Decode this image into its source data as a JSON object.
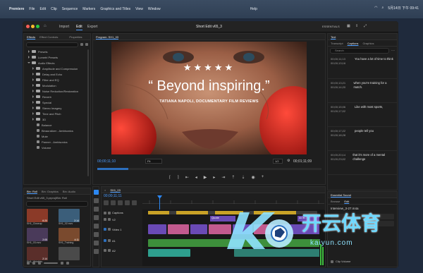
{
  "menubar": {
    "apple": "",
    "items": [
      "Premiere",
      "File",
      "Edit",
      "Clip",
      "Sequence",
      "Markers",
      "Graphics and Titles",
      "View",
      "Window",
      "Help"
    ],
    "clock": "5月14日 下午 09:41"
  },
  "header": {
    "tabs": [
      "Import",
      "Edit",
      "Export"
    ],
    "active_tab": "Edit",
    "project_title": "Short Edit v65_3",
    "workspace": "ESSENTIALS"
  },
  "effects_panel": {
    "tabs": [
      "Effects",
      "Effect Controls",
      "Properties"
    ],
    "search_placeholder": "",
    "tree": [
      {
        "label": "Presets",
        "type": "folder",
        "level": 0
      },
      {
        "label": "Lumetri Presets",
        "type": "folder",
        "level": 0
      },
      {
        "label": "Audio Effects",
        "type": "folder",
        "level": 0,
        "open": true
      },
      {
        "label": "Amplitude and Compression",
        "type": "folder",
        "level": 1
      },
      {
        "label": "Delay and Echo",
        "type": "folder",
        "level": 1
      },
      {
        "label": "Filter and EQ",
        "type": "folder",
        "level": 1
      },
      {
        "label": "Modulation",
        "type": "folder",
        "level": 1
      },
      {
        "label": "Noise Reduction/Restoration",
        "type": "folder",
        "level": 1
      },
      {
        "label": "Reverb",
        "type": "folder",
        "level": 1
      },
      {
        "label": "Special",
        "type": "folder",
        "level": 1
      },
      {
        "label": "Stereo Imagery",
        "type": "folder",
        "level": 1
      },
      {
        "label": "Time and Pitch",
        "type": "folder",
        "level": 1
      },
      {
        "label": "3D",
        "type": "folder",
        "level": 1
      },
      {
        "label": "Balance",
        "type": "item",
        "level": 2
      },
      {
        "label": "Binauralizer - Ambisonics",
        "type": "item",
        "level": 2
      },
      {
        "label": "Mute",
        "type": "item",
        "level": 2
      },
      {
        "label": "Panner - Ambisonics",
        "type": "item",
        "level": 2
      },
      {
        "label": "Volume",
        "type": "item",
        "level": 2
      }
    ]
  },
  "bin_panel": {
    "tabs": [
      "Bin: Roll",
      "Bin: Graphics",
      "Bin: Audio"
    ],
    "project_file": "Short Edit v65_3.prproj/Bin: Roll",
    "thumbnails": [
      {
        "label": "SH1_Closeup",
        "duration": "6:20",
        "color": "#8b3a28"
      },
      {
        "label": "SH1_02.mov",
        "duration": "2:14",
        "color": "#3b5e7a"
      },
      {
        "label": "SH1_03.mov",
        "duration": "2:05",
        "color": "#4a3a5a"
      },
      {
        "label": "SH1_Training",
        "duration": "4:11",
        "color": "#7a4a2e"
      },
      {
        "label": "SH1_Wrinkles",
        "duration": "2:14",
        "color": "#5a2e2a"
      },
      {
        "label": "",
        "duration": "",
        "color": "#4a4a4a"
      }
    ]
  },
  "program_monitor": {
    "title": "Program: SH1_03",
    "stars": "★★★★★",
    "quote": "“ Beyond inspiring.”",
    "credit": "TATIANA NAPOLI, DOCUMENTARY FILM REVIEWS",
    "timecode_current": "00;00;11;10",
    "fit": "Fit",
    "quality": "1/2",
    "timecode_end": "00;01;11;09"
  },
  "text_panel": {
    "title": "Text",
    "tabs": [
      "Transcript",
      "Captions",
      "Graphics"
    ],
    "active_tab": "Captions",
    "search_placeholder": "Search",
    "captions": [
      {
        "tc": "00;00;11;13\n00;00;13;16",
        "text": "You have a lot of time to think"
      },
      {
        "tc": "00;00;13;21\n00;00;14;20",
        "text": "when you're training for a match."
      },
      {
        "tc": "00;00;15;06\n00;00;17;02",
        "text": "Like with most sports,"
      },
      {
        "tc": "00;00;17;22\n00;00;18;28",
        "text": "people tell you"
      },
      {
        "tc": "00;00;20;14\n00;00;23;02",
        "text": "that it's more of a mental challenge"
      }
    ]
  },
  "essential_sound": {
    "title": "Essential Sound",
    "tabs": [
      "Browse",
      "Edit"
    ],
    "clip_name": "Interview_3-27.m4a",
    "clip_volume": "Clip Volume"
  },
  "timeline": {
    "sequence": "SH1_03",
    "timecode": "00;00;11;11",
    "tracks": [
      {
        "name": "Captions",
        "kind": "caption"
      },
      {
        "name": "V2",
        "kind": "video"
      },
      {
        "name": "Video 1",
        "kind": "video"
      },
      {
        "name": "A1",
        "kind": "audio"
      },
      {
        "name": "A2",
        "kind": "audio"
      }
    ],
    "clip_labels": [
      "Quote",
      "At in..."
    ]
  },
  "watermark": {
    "text": "开云体育",
    "sub": "kaiyun.com",
    "brand_color": "#6fd8ff"
  },
  "colors": {
    "accent": "#4b9cff",
    "playhead": "#2c88f3",
    "clip_purple": "#6a4ab5",
    "clip_pink": "#c25a8e",
    "clip_teal": "#2e9f8e",
    "audio_green": "#3d8f3b"
  }
}
